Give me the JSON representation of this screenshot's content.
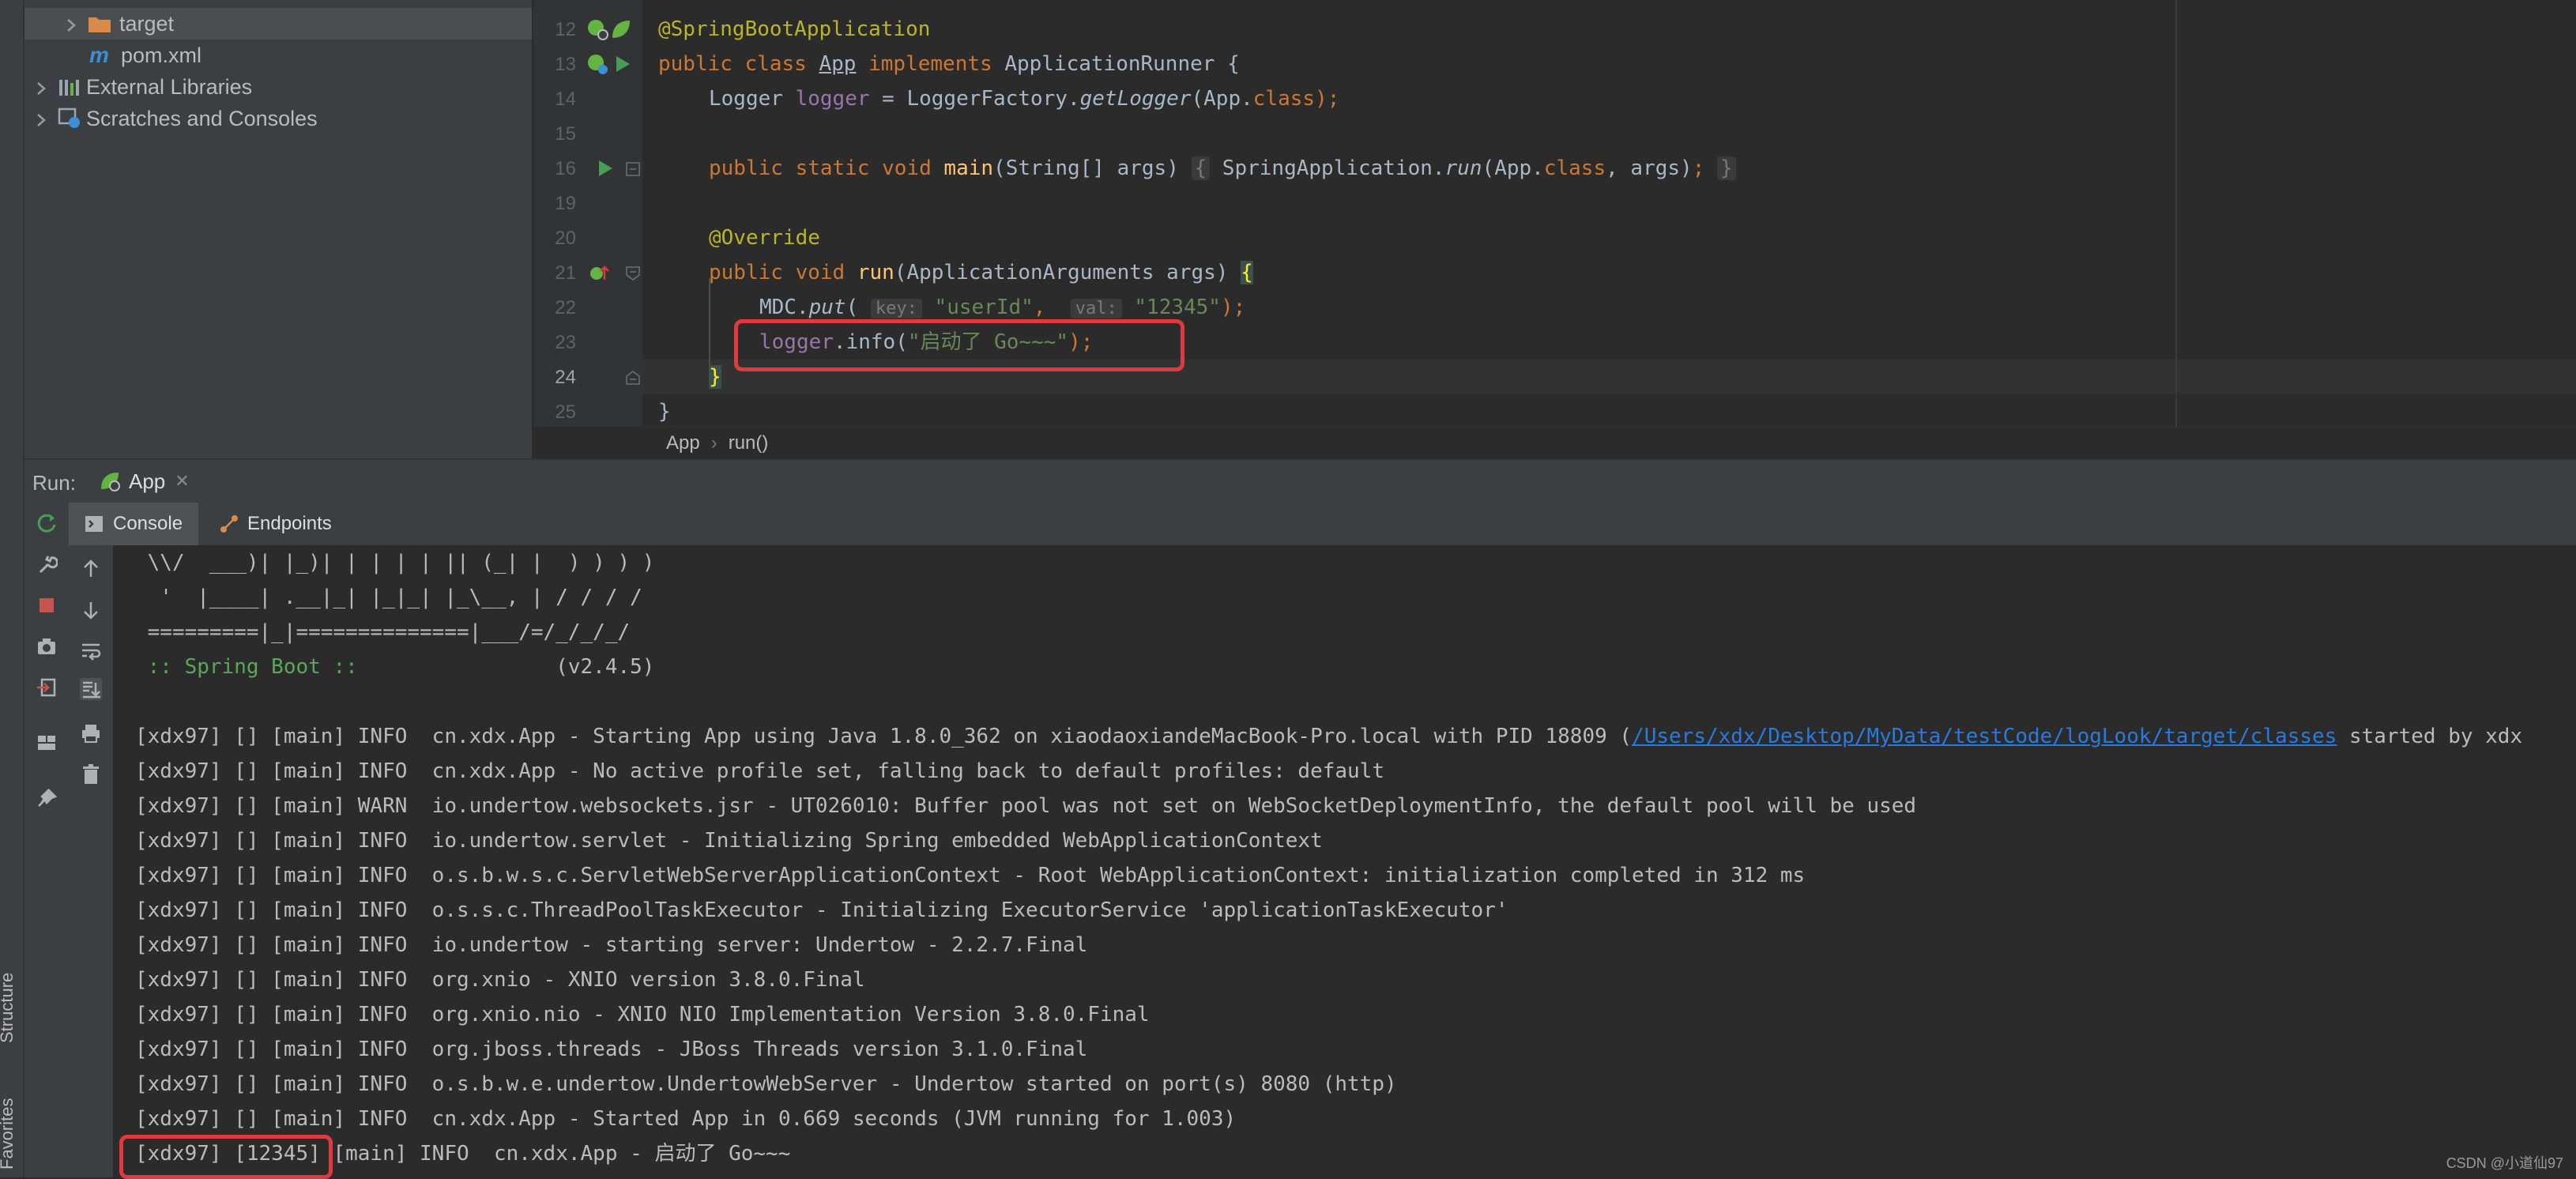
{
  "sidebar": {
    "structure_label": "Structure",
    "favorites_label": "Favorites"
  },
  "project": {
    "items": [
      {
        "label": "target",
        "icon": "folder-icon",
        "selected": true
      },
      {
        "label": "pom.xml",
        "icon": "maven-icon"
      },
      {
        "label": "External Libraries",
        "icon": "library-icon"
      },
      {
        "label": "Scratches and Consoles",
        "icon": "scratches-icon"
      }
    ]
  },
  "editor": {
    "line_numbers": [
      "12",
      "13",
      "14",
      "15",
      "16",
      "19",
      "20",
      "21",
      "22",
      "23",
      "24",
      "25"
    ],
    "lines": {
      "l12_ann": "@SpringBootApplication",
      "l13_kw1": "public class ",
      "l13_cls": "App",
      "l13_kw2": " implements ",
      "l13_rest": "ApplicationRunner {",
      "l14_type": "Logger ",
      "l14_field": "logger",
      "l14_eq": " = LoggerFactory.",
      "l14_method": "getLogger",
      "l14_arg": "(App.",
      "l14_kwclass": "class",
      "l14_end": ");",
      "l16_kw": "public static void ",
      "l16_fn": "main",
      "l16_params": "(String[] args) ",
      "l16_fold_open": "{",
      "l16_body1": " SpringApplication.",
      "l16_run": "run",
      "l16_body2": "(App.",
      "l16_kwclass": "class",
      "l16_body3": ", args)",
      "l16_semi": ";",
      "l16_fold_close": "}",
      "l20_ann": "@Override",
      "l21_kw": "public void ",
      "l21_fn": "run",
      "l21_params": "(ApplicationArguments args) ",
      "l21_brace": "{",
      "l22_mdc": "MDC.",
      "l22_put": "put",
      "l22_open": "(",
      "l22_hint_key": "key:",
      "l22_str1": "\"userId\"",
      "l22_comma": ",",
      "l22_hint_val": "val:",
      "l22_str2": "\"12345\"",
      "l22_end": ");",
      "l23_field": "logger",
      "l23_call": ".info(",
      "l23_str": "\"启动了 Go~~~\"",
      "l23_end": ");",
      "l24_brace": "}",
      "l25_brace": "}"
    },
    "breadcrumb": [
      "App",
      "run()"
    ]
  },
  "run": {
    "label": "Run:",
    "tab": "App",
    "subtabs": [
      "Console",
      "Endpoints"
    ]
  },
  "console": {
    "banner": [
      " \\\\/  ___)| |_)| | | | | || (_| |  ) ) ) )",
      "  '  |____| .__|_| |_|_| |_\\__, | / / / /",
      " =========|_|==============|___/=/_/_/_/"
    ],
    "spring_label": " :: Spring Boot :: ",
    "spring_version": "               (v2.4.5)",
    "log_first_prefix": "[xdx97] [] [main] INFO  cn.xdx.App - Starting App using Java 1.8.0_362 on xiaodaoxiandeMacBook-Pro.local with PID 18809 (",
    "log_first_link": "/Users/xdx/Desktop/MyData/testCode/logLook/target/classes",
    "log_first_suffix": " started by xdx",
    "logs": [
      "[xdx97] [] [main] INFO  cn.xdx.App - No active profile set, falling back to default profiles: default",
      "[xdx97] [] [main] WARN  io.undertow.websockets.jsr - UT026010: Buffer pool was not set on WebSocketDeploymentInfo, the default pool will be used",
      "[xdx97] [] [main] INFO  io.undertow.servlet - Initializing Spring embedded WebApplicationContext",
      "[xdx97] [] [main] INFO  o.s.b.w.s.c.ServletWebServerApplicationContext - Root WebApplicationContext: initialization completed in 312 ms",
      "[xdx97] [] [main] INFO  o.s.s.c.ThreadPoolTaskExecutor - Initializing ExecutorService 'applicationTaskExecutor'",
      "[xdx97] [] [main] INFO  io.undertow - starting server: Undertow - 2.2.7.Final",
      "[xdx97] [] [main] INFO  org.xnio - XNIO version 3.8.0.Final",
      "[xdx97] [] [main] INFO  org.xnio.nio - XNIO NIO Implementation Version 3.8.0.Final",
      "[xdx97] [] [main] INFO  org.jboss.threads - JBoss Threads version 3.1.0.Final",
      "[xdx97] [] [main] INFO  o.s.b.w.e.undertow.UndertowWebServer - Undertow started on port(s) 8080 (http)",
      "[xdx97] [] [main] INFO  cn.xdx.App - Started App in 0.669 seconds (JVM running for 1.003)"
    ],
    "last_log": "[xdx97] [12345] [main] INFO  cn.xdx.App - 启动了 Go~~~"
  },
  "watermark": "CSDN @小道仙97",
  "colors": {
    "highlight_box": "#e0393e",
    "tab_underline": "#4a88c7"
  }
}
